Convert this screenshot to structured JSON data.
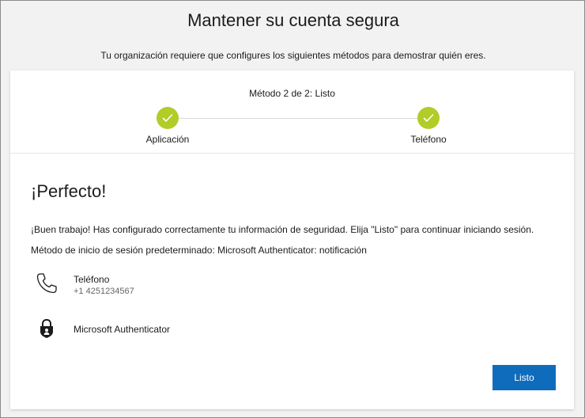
{
  "header": {
    "title": "Mantener su cuenta segura",
    "subtitle": "Tu organización requiere que configures los siguientes métodos para demostrar quién eres."
  },
  "progress": {
    "counter": "Método 2 de 2: Listo",
    "steps": [
      {
        "label": "Aplicación",
        "status": "complete",
        "icon": "checkmark-icon"
      },
      {
        "label": "Teléfono",
        "status": "complete",
        "icon": "checkmark-icon"
      }
    ],
    "complete_color": "#b2cc28"
  },
  "content": {
    "heading": "¡Perfecto!",
    "message": "¡Buen trabajo! Has configurado correctamente tu información de seguridad. Elija \"Listo\" para continuar iniciando sesión.",
    "default_method": "Método de inicio de sesión predeterminado: Microsoft Authenticator: notificación",
    "methods": [
      {
        "name": "Teléfono",
        "detail": "+1 4251234567",
        "icon": "phone-icon"
      },
      {
        "name": "Microsoft Authenticator",
        "icon": "authenticator-lock-icon"
      }
    ]
  },
  "actions": {
    "done_label": "Listo",
    "accent": "#0f6cbd"
  }
}
